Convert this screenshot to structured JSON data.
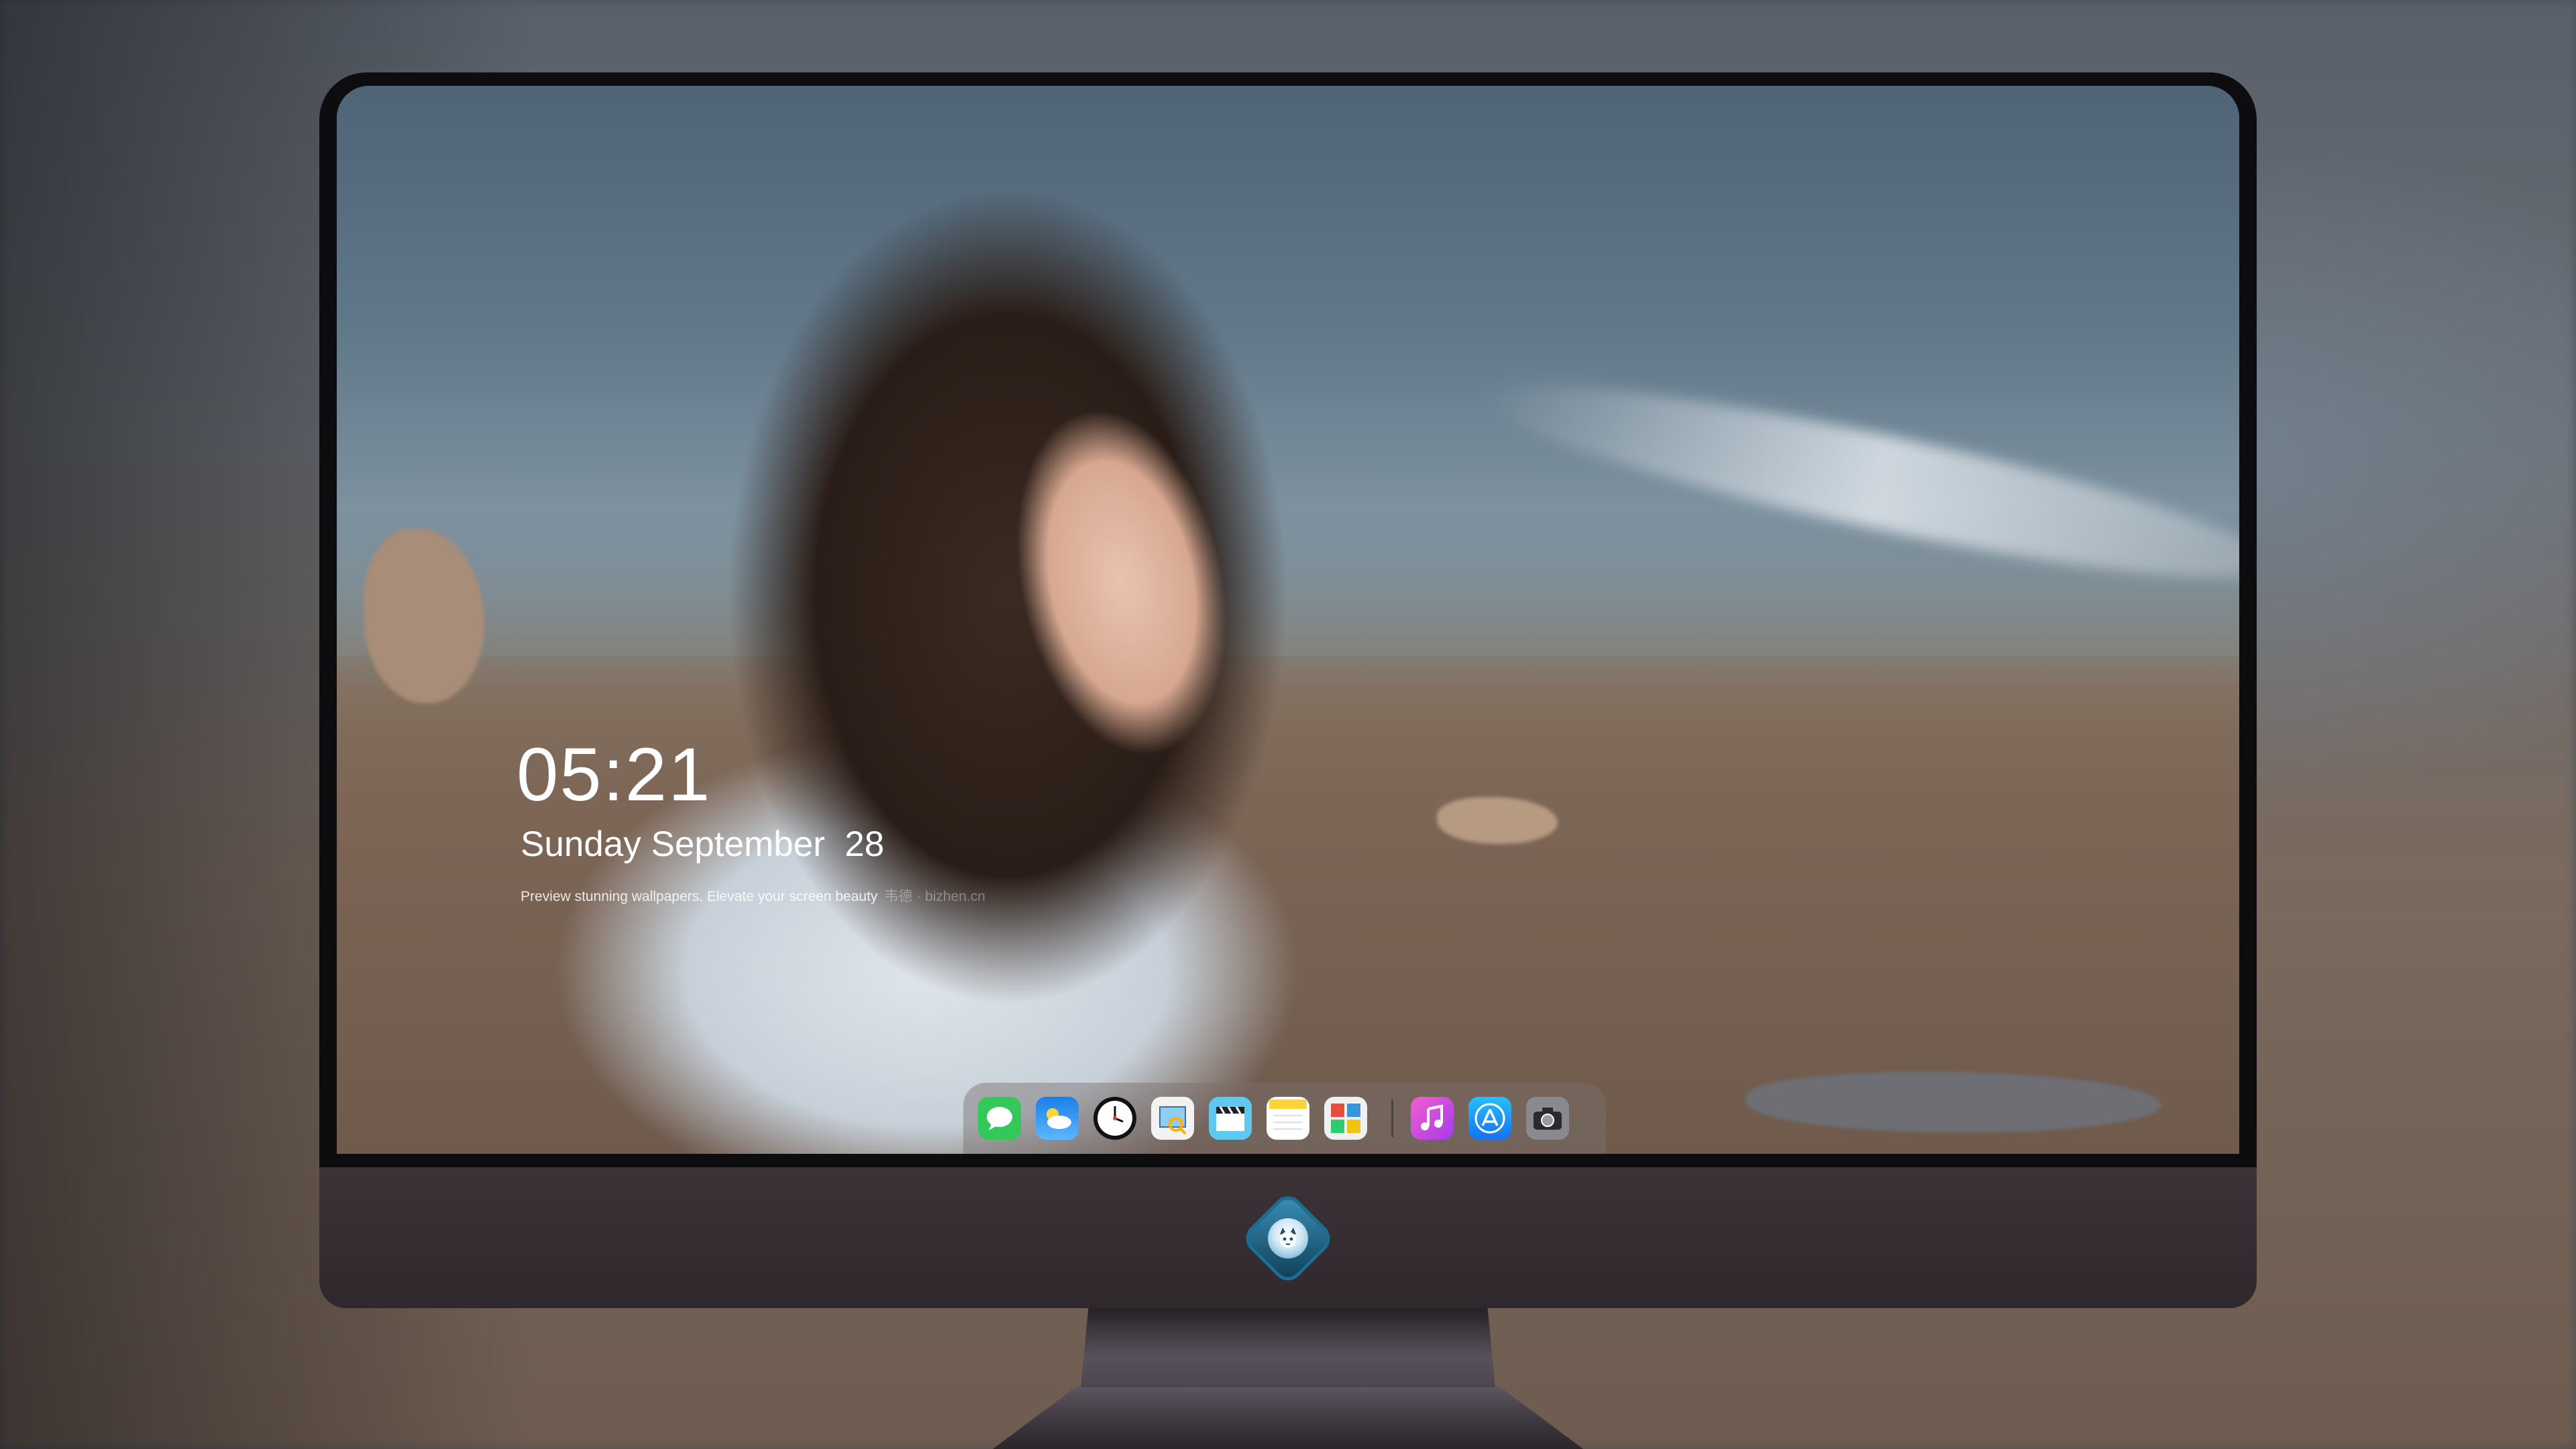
{
  "lockscreen": {
    "time": "05:21",
    "date": "Sunday September  28",
    "tagline": "Preview stunning wallpapers. Elevate your screen beauty",
    "watermark": "韦德 · bizhen.cn"
  },
  "dock": {
    "apps": [
      {
        "name": "Messages",
        "icon": "message-icon",
        "color": "#34c759"
      },
      {
        "name": "Weather",
        "icon": "weather-icon",
        "color": "#1e8df0"
      },
      {
        "name": "Clock",
        "icon": "clock-icon",
        "color": "#111111"
      },
      {
        "name": "Preview",
        "icon": "preview-icon",
        "color": "#f2f2f2"
      },
      {
        "name": "Clips",
        "icon": "clapperboard-icon",
        "color": "#5ec8ee"
      },
      {
        "name": "Notes",
        "icon": "notes-icon",
        "color": "#fdd33a"
      },
      {
        "name": "Photo Booth",
        "icon": "photo-booth-icon",
        "color": "#f0f0f0"
      },
      {
        "name": "iTunes",
        "icon": "music-note-icon",
        "color": "#e14ae0"
      },
      {
        "name": "App Store",
        "icon": "app-store-icon",
        "color": "#2a8cf5"
      },
      {
        "name": "Camera",
        "icon": "camera-icon",
        "color": "#8a8a8e"
      }
    ]
  },
  "monitor": {
    "logo_icon": "cat-emblem-icon",
    "chin_color": "#342c31"
  }
}
